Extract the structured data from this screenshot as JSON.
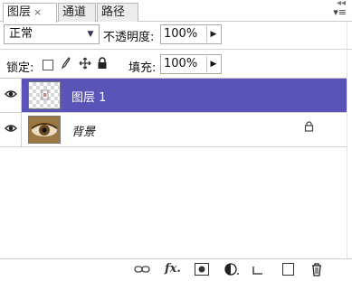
{
  "tabs": [
    {
      "label": "图层",
      "active": true,
      "closable": true
    },
    {
      "label": "通道",
      "active": false
    },
    {
      "label": "路径",
      "active": false
    }
  ],
  "tab_close_glyph": "×",
  "blend_mode": {
    "value": "正常",
    "arrow_icon": "chevron-down-icon"
  },
  "opacity": {
    "label": "不透明度:",
    "value": "100%"
  },
  "lock": {
    "label": "锁定:",
    "icons": [
      "lock-transparent-icon",
      "lock-image-icon",
      "lock-position-icon",
      "lock-all-icon"
    ]
  },
  "fill": {
    "label": "填充:",
    "value": "100%"
  },
  "layers": [
    {
      "name": "图层 1",
      "visible": true,
      "selected": true,
      "locked": false,
      "thumbnail": "transparent-layer"
    },
    {
      "name": "背景",
      "visible": true,
      "selected": false,
      "locked": true,
      "italic": true,
      "thumbnail": "eye-photo"
    }
  ],
  "toolbar_icons": [
    "link-icon",
    "fx-icon",
    "layer-mask-icon",
    "adjustment-layer-icon",
    "group-folder-icon",
    "new-layer-icon",
    "trash-icon"
  ],
  "toolbar_fx_label": "fx.",
  "colors": {
    "selection": "#5a54b8"
  }
}
